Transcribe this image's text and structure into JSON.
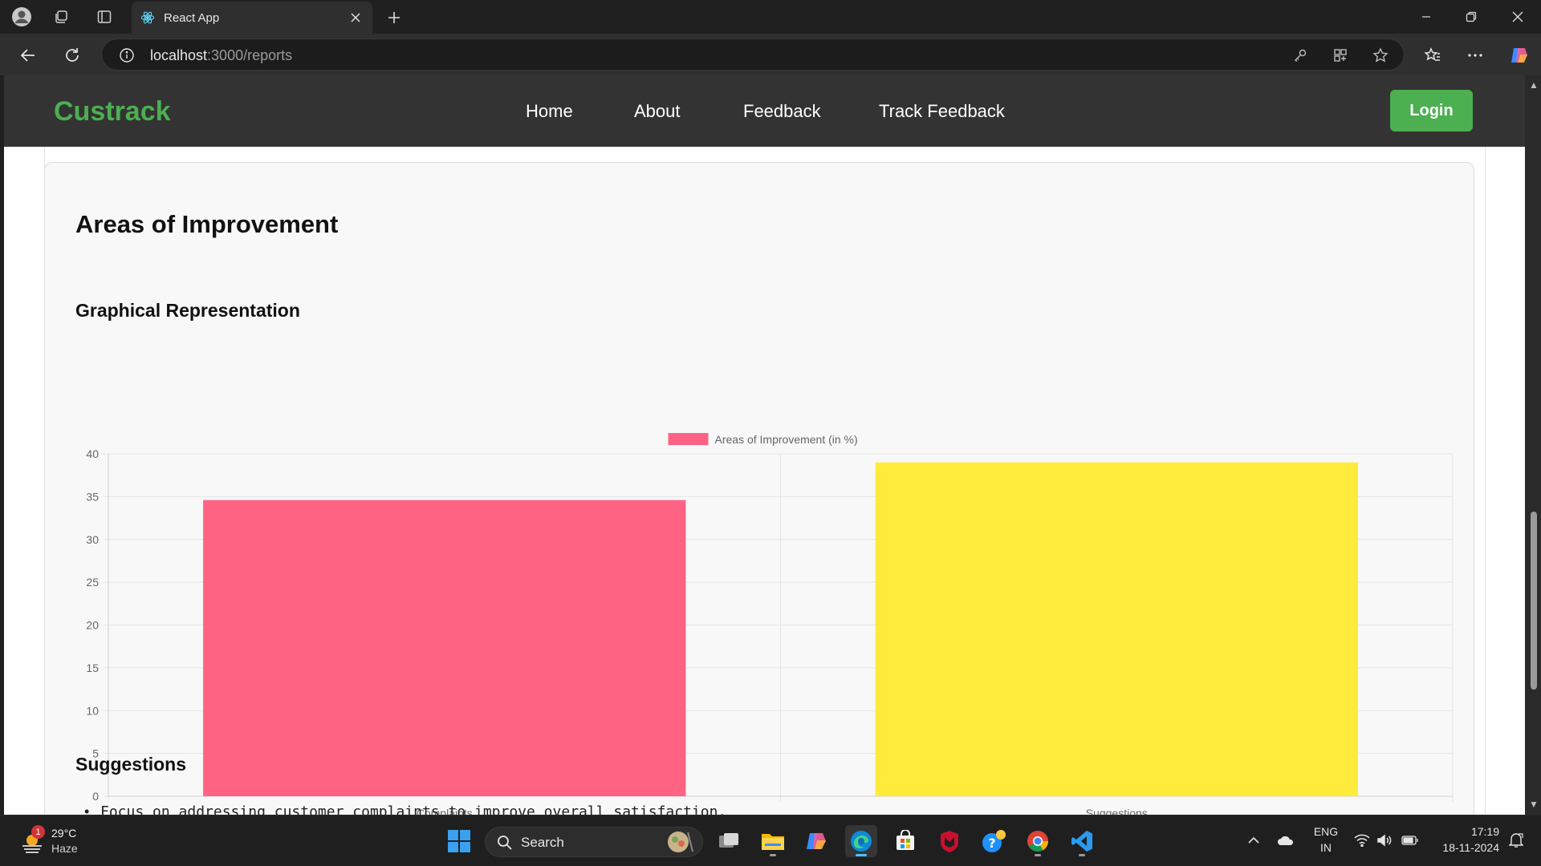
{
  "browser": {
    "tab_title": "React App",
    "url_host": "localhost",
    "url_rest": ":3000/reports"
  },
  "navbar": {
    "brand": "Custrack",
    "links": [
      "Home",
      "About",
      "Feedback",
      "Track Feedback"
    ],
    "login_label": "Login"
  },
  "content": {
    "section_title": "Areas of Improvement",
    "chart_heading": "Graphical Representation",
    "suggestions_heading": "Suggestions",
    "suggestions": [
      "Focus on addressing customer complaints to improve overall satisfaction."
    ]
  },
  "chart_data": {
    "type": "bar",
    "categories": [
      "Complaints",
      "Suggestions"
    ],
    "series": [
      {
        "name": "Areas of Improvement (in %)",
        "values": [
          34.6,
          39
        ],
        "colors": [
          "#ff6384",
          "#ffeb3b"
        ]
      }
    ],
    "ylim": [
      0,
      40
    ],
    "yticks": [
      0,
      5,
      10,
      15,
      20,
      25,
      30,
      35,
      40
    ],
    "grid": true,
    "legend_position": "top"
  },
  "taskbar": {
    "weather_temp": "29°C",
    "weather_cond": "Haze",
    "weather_badge": "1",
    "search_label": "Search",
    "lang_top": "ENG",
    "lang_bottom": "IN",
    "time": "17:19",
    "date": "18-11-2024"
  },
  "colors": {
    "brand_green": "#4caf50",
    "navbar_bg": "#333333",
    "bar_pink": "#ff6384",
    "bar_yellow": "#ffeb3b"
  }
}
